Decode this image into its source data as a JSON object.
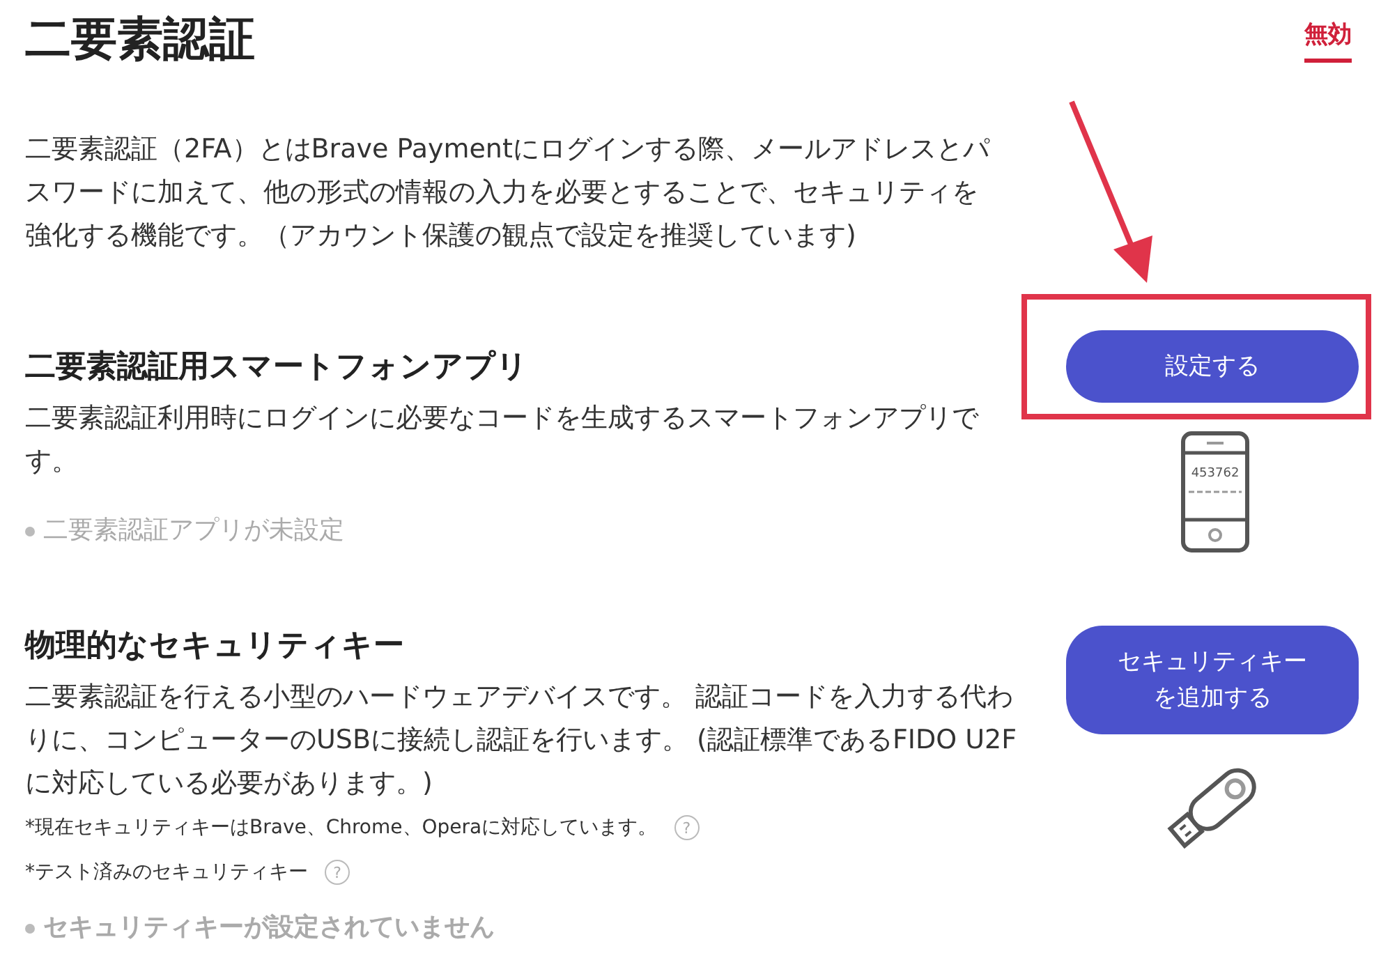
{
  "header": {
    "title": "二要素認証",
    "status": "無効"
  },
  "intro": "二要素認証（2FA）とはBrave Paymentにログインする際、メールアドレスとパスワードに加えて、他の形式の情報の入力を必要とすることで、セキュリティを強化する機能です。（アカウント保護の観点で設定を推奨しています)",
  "sections": [
    {
      "heading": "二要素認証用スマートフォンアプリ",
      "description": "二要素認証利用時にログインに必要なコードを生成するスマートフォンアプリです。",
      "status": "二要素認証アプリが未設定",
      "emphasized": false,
      "button": "設定する",
      "highlighted": true,
      "illustration": {
        "kind": "phone",
        "code": "453762"
      }
    },
    {
      "heading": "物理的なセキュリティキー",
      "description": "二要素認証を行える小型のハードウェアデバイスです。 認証コードを入力する代わりに、コンピューターのUSBに接続し認証を行います。 (認証標準であるFIDO U2Fに対応している必要があります。)",
      "notes": [
        {
          "text": "*現在セキュリティキーはBrave、Chrome、Operaに対応しています。",
          "help": "?"
        },
        {
          "text": "*テスト済みのセキュリティキー",
          "help": "?"
        }
      ],
      "status": "セキュリティキーが設定されていません",
      "emphasized": true,
      "button": "セキュリティキーを追加する",
      "highlighted": false,
      "illustration": {
        "kind": "usb"
      }
    }
  ]
}
